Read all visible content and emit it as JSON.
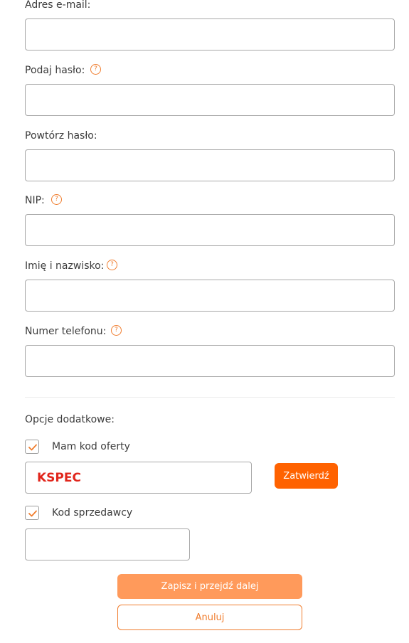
{
  "form": {
    "email": {
      "label": "Adres e-mail:",
      "value": ""
    },
    "password": {
      "label": "Podaj hasło:",
      "value": ""
    },
    "password_repeat": {
      "label": "Powtórz hasło:",
      "value": ""
    },
    "nip": {
      "label": "NIP:",
      "value": ""
    },
    "name": {
      "label": "Imię i nazwisko:",
      "value": ""
    },
    "phone": {
      "label": "Numer telefonu:",
      "value": ""
    },
    "help_glyph": "?"
  },
  "options": {
    "heading": "Opcje dodatkowe:",
    "offer_code": {
      "label": "Mam kod oferty",
      "checked": true,
      "value": "KSPEC",
      "confirm_label": "Zatwierdź"
    },
    "seller_code": {
      "label": "Kod sprzedawcy",
      "checked": true,
      "value": ""
    }
  },
  "actions": {
    "save_label": "Zapisz i przejdź dalej",
    "cancel_label": "Anuluj"
  },
  "colors": {
    "accent": "#ff6200",
    "accent_light": "#ff9a5b",
    "icon": "#f07d2e",
    "promo_text": "#e1261c"
  }
}
